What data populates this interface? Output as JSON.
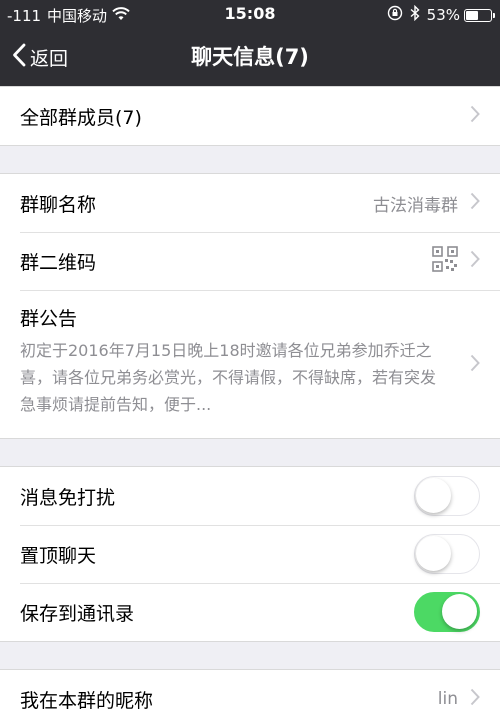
{
  "status_bar": {
    "signal": "-111",
    "carrier": "中国移动",
    "time": "15:08",
    "battery_percent": "53%",
    "battery_level": 0.53
  },
  "nav": {
    "back_label": "返回",
    "title": "聊天信息(7)"
  },
  "members": {
    "label": "全部群成员(7)"
  },
  "group": {
    "name_label": "群聊名称",
    "name_value": "古法消毒群",
    "qr_label": "群二维码",
    "notice_label": "群公告",
    "notice_text": "初定于2016年7月15日晚上18时邀请各位兄弟参加乔迁之喜，请各位兄弟务必赏光，不得请假，不得缺席，若有突发急事烦请提前告知，便于..."
  },
  "settings": {
    "mute_label": "消息免打扰",
    "mute_on": false,
    "pin_label": "置顶聊天",
    "pin_on": false,
    "save_label": "保存到通讯录",
    "save_on": true
  },
  "nickname": {
    "label": "我在本群的昵称",
    "value": "lin"
  },
  "colors": {
    "nav_bg": "#2e2e33",
    "toggle_on": "#4cd964",
    "page_bg": "#efeff4"
  }
}
